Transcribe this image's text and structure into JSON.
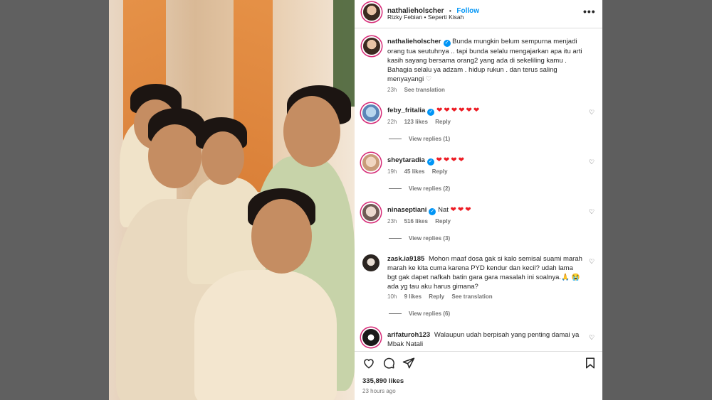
{
  "post": {
    "username": "nathalieholscher",
    "follow_label": "Follow",
    "separator": "•",
    "audio": "Rizky Febian • Seperti Kisah",
    "caption": "Bunda mungkin belum sempurna menjadi orang tua seutuhnya .. tapi bunda selalu mengajarkan apa itu arti kasih sayang bersama orang2 yang ada di sekeliling kamu . Bahagia selalu ya adzam . hidup rukun . dan terus saling menyayangi",
    "caption_heart": "♡",
    "caption_time": "23h",
    "see_translation": "See translation",
    "more_icon": "more-options-icon"
  },
  "comments": [
    {
      "username": "feby_fritalia",
      "verified": true,
      "text": "",
      "hearts": "❤❤❤❤❤❤",
      "time": "22h",
      "likes": "123 likes",
      "reply": "Reply",
      "view_replies": "View replies (1)"
    },
    {
      "username": "sheytaradia",
      "verified": true,
      "text": "",
      "hearts": "❤❤❤❤",
      "time": "19h",
      "likes": "45 likes",
      "reply": "Reply",
      "view_replies": "View replies (2)"
    },
    {
      "username": "ninaseptiani",
      "verified": true,
      "text": "Nat",
      "hearts": "❤❤❤",
      "time": "23h",
      "likes": "516 likes",
      "reply": "Reply",
      "view_replies": "View replies (3)"
    },
    {
      "username": "zask.ia9185",
      "verified": false,
      "text": "Mohon maaf dosa gak si kalo semisal suami marah marah ke kita cuma karena PYD kendur dan kecil? udah lama bgt gak dapet nafkah batin gara gara masalah ini soalnya.🙏 😭 ada yg tau aku harus gimana?",
      "hearts": "",
      "time": "10h",
      "likes": "9 likes",
      "reply": "Reply",
      "see_translation": "See translation",
      "view_replies": "View replies (6)"
    },
    {
      "username": "arifaturoh123",
      "verified": false,
      "text": "Walaupun udah berpisah yang penting damai ya Mbak Natali",
      "hearts": ""
    }
  ],
  "footer": {
    "likes": "335,890 likes",
    "time_ago": "23 hours ago"
  },
  "colors": {
    "accent": "#0095f6",
    "heart": "#ed1c24",
    "muted": "#737373",
    "text": "#262626"
  }
}
